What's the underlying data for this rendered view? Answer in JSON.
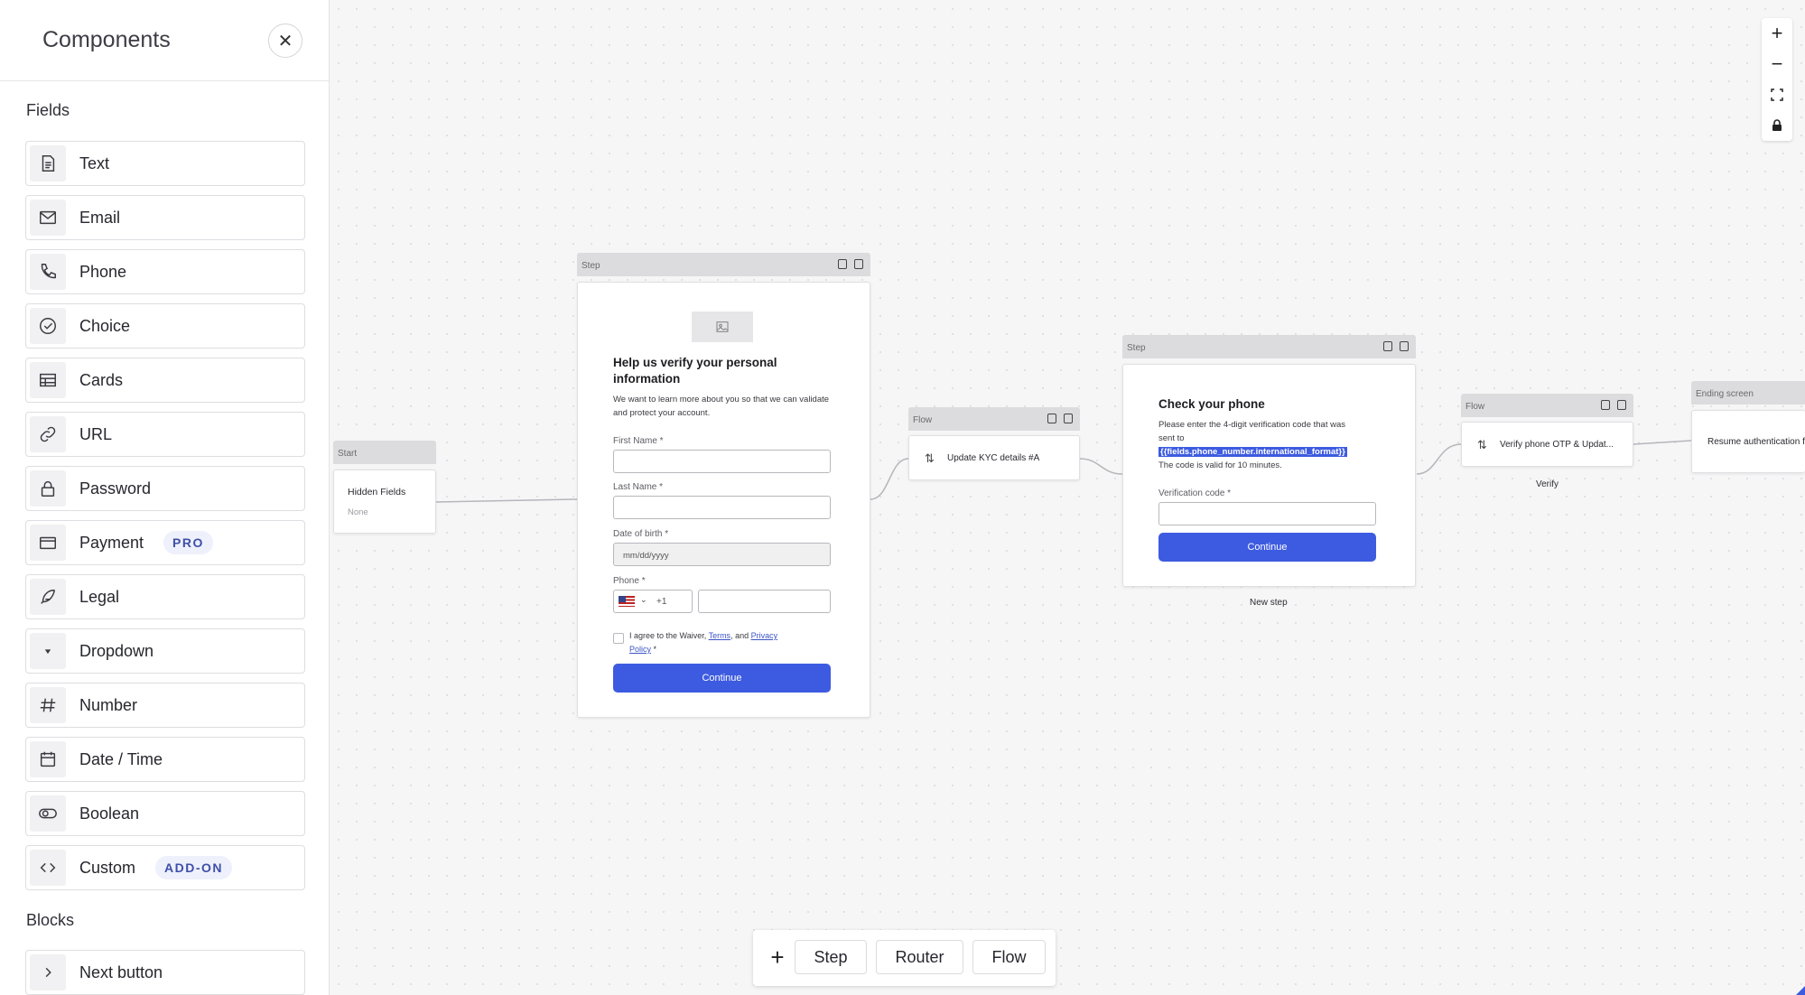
{
  "sidebar": {
    "title": "Components",
    "sections": {
      "fields": "Fields",
      "blocks": "Blocks"
    },
    "fields": [
      {
        "label": "Text",
        "icon": "text-doc-icon"
      },
      {
        "label": "Email",
        "icon": "envelope-icon"
      },
      {
        "label": "Phone",
        "icon": "phone-icon"
      },
      {
        "label": "Choice",
        "icon": "check-circle-icon"
      },
      {
        "label": "Cards",
        "icon": "cards-icon"
      },
      {
        "label": "URL",
        "icon": "link-icon"
      },
      {
        "label": "Password",
        "icon": "lock-icon"
      },
      {
        "label": "Payment",
        "icon": "credit-card-icon",
        "badge": "PRO"
      },
      {
        "label": "Legal",
        "icon": "feather-icon"
      },
      {
        "label": "Dropdown",
        "icon": "caret-down-icon"
      },
      {
        "label": "Number",
        "icon": "hash-icon"
      },
      {
        "label": "Date / Time",
        "icon": "calendar-icon"
      },
      {
        "label": "Boolean",
        "icon": "toggle-icon"
      },
      {
        "label": "Custom",
        "icon": "code-icon",
        "badge": "ADD-ON"
      }
    ],
    "blocks": [
      {
        "label": "Next button",
        "icon": "chevron-right-icon"
      }
    ]
  },
  "canvas": {
    "start_node": {
      "header": "Start",
      "title": "Hidden Fields",
      "value": "None"
    },
    "step1": {
      "header": "Step",
      "heading": "Help us verify your personal information",
      "subtext": "We want to learn more about you so that we can validate and protect your account.",
      "first_name_label": "First Name *",
      "last_name_label": "Last Name *",
      "dob_label": "Date of birth *",
      "dob_placeholder": "mm/dd/yyyy",
      "phone_label": "Phone *",
      "phone_code": "+1",
      "agree_prefix": "I agree to the Waiver, ",
      "terms": "Terms",
      "agree_mid": ", and ",
      "privacy1": "Privacy ",
      "privacy2": "Policy",
      "agree_suffix": " *",
      "button": "Continue"
    },
    "flow1": {
      "header": "Flow",
      "label": "Update KYC details #A"
    },
    "step2": {
      "header": "Step",
      "heading": "Check your phone",
      "text1": "Please enter the 4-digit verification code that was sent to",
      "highlight": "{{fields.phone_number.international_format}}",
      "text2": "The code is valid for 10 minutes.",
      "code_label": "Verification code *",
      "button": "Continue",
      "caption": "New step"
    },
    "flow2": {
      "header": "Flow",
      "label": "Verify phone OTP & Updat...",
      "caption": "Verify"
    },
    "ending": {
      "header": "Ending screen",
      "label": "Resume authentication f"
    }
  },
  "zoom_controls": {
    "plus": "+",
    "minus": "−"
  },
  "bottom_bar": {
    "add": "+",
    "step": "Step",
    "router": "Router",
    "flow": "Flow"
  },
  "colors": {
    "accent": "#3d5be0",
    "badge_bg": "#eef0fb",
    "badge_text": "#3f4fa8",
    "highlight_bg": "#3d5be0"
  }
}
